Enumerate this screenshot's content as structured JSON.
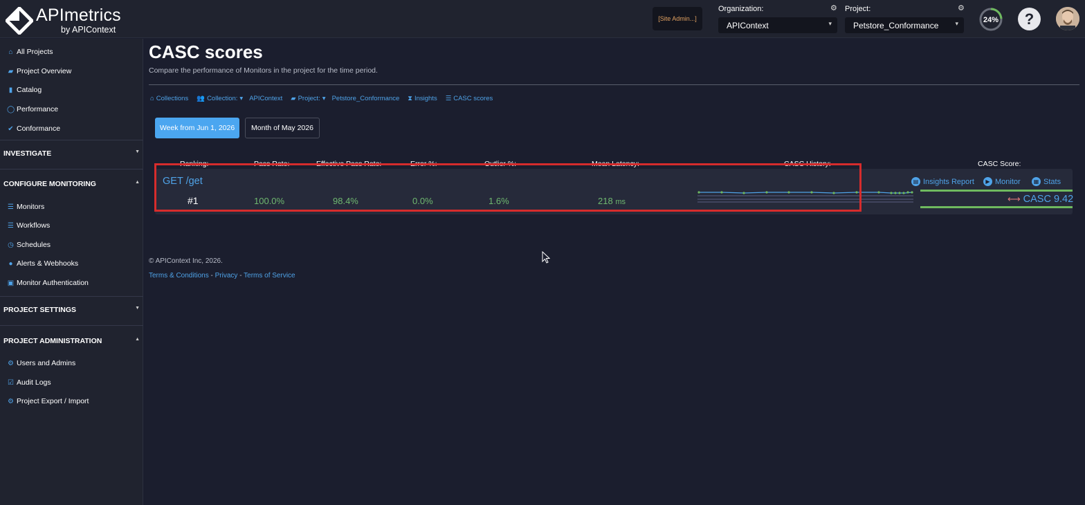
{
  "header": {
    "logo_title": "APImetrics",
    "logo_sub": "by APIContext",
    "site_admin": "[Site Admin...]",
    "organization_label": "Organization:",
    "organization_value": "APIContext",
    "project_label": "Project:",
    "project_value": "Petstore_Conformance",
    "usage_percent": "24%",
    "usage_fraction": 0.24,
    "help_label": "?"
  },
  "sidebar": {
    "top_items": [
      {
        "label": "All Projects",
        "icon": "home-icon"
      },
      {
        "label": "Project Overview",
        "icon": "folder-open-icon"
      },
      {
        "label": "Catalog",
        "icon": "book-icon"
      },
      {
        "label": "Performance",
        "icon": "dashboard-icon"
      },
      {
        "label": "Conformance",
        "icon": "check-icon"
      }
    ],
    "investigate": "INVESTIGATE",
    "configure_monitoring": "CONFIGURE MONITORING",
    "monitoring_items": [
      {
        "label": "Monitors",
        "icon": "list-icon"
      },
      {
        "label": "Workflows",
        "icon": "list-icon"
      },
      {
        "label": "Schedules",
        "icon": "clock-icon"
      },
      {
        "label": "Alerts & Webhooks",
        "icon": "globe-icon"
      },
      {
        "label": "Monitor Authentication",
        "icon": "lock-icon"
      }
    ],
    "project_settings": "PROJECT SETTINGS",
    "project_administration": "PROJECT ADMINISTRATION",
    "admin_items": [
      {
        "label": "Users and Admins",
        "icon": "gear-icon"
      },
      {
        "label": "Audit Logs",
        "icon": "checkbox-icon"
      },
      {
        "label": "Project Export / Import",
        "icon": "gear-icon"
      }
    ]
  },
  "main": {
    "title": "CASC scores",
    "subtitle": "Compare the performance of Monitors in the project for the time period.",
    "breadcrumb": {
      "collections": "Collections",
      "collection_label": "Collection:",
      "collection_value": "APIContext",
      "project_label": "Project:",
      "project_value": "Petstore_Conformance",
      "insights": "Insights",
      "casc_scores": "CASC scores"
    },
    "periods": {
      "active": "Week from Jun 1, 2026",
      "other": "Month of May 2026"
    },
    "columns": {
      "ranking": "Ranking:",
      "pass_rate": "Pass Rate:",
      "effective_pass_rate": "Effective Pass Rate:",
      "error": "Error %:",
      "outlier": "Outlier %:",
      "mean_latency": "Mean Latency:",
      "casc_history": "CASC History:",
      "casc_score": "CASC Score:"
    },
    "row": {
      "name": "GET /get",
      "rank": "#1",
      "pass_rate": "100.0%",
      "effective_pass_rate": "98.4%",
      "error": "0.0%",
      "outlier": "1.6%",
      "mean_latency": "218",
      "latency_unit": "ms",
      "insights_report": "Insights Report",
      "monitor": "Monitor",
      "stats": "Stats",
      "casc_score": "CASC 9.42"
    }
  },
  "footer": {
    "copyright": "© APIContext Inc, 2026.",
    "terms": "Terms & Conditions",
    "sep1": "-",
    "privacy": "Privacy",
    "sep2": "-",
    "service": "Terms of Service"
  },
  "colors": {
    "accent": "#4fa3e8",
    "positive": "#6fb86f",
    "highlight": "#d62c2c",
    "background": "#1b1e2e"
  }
}
